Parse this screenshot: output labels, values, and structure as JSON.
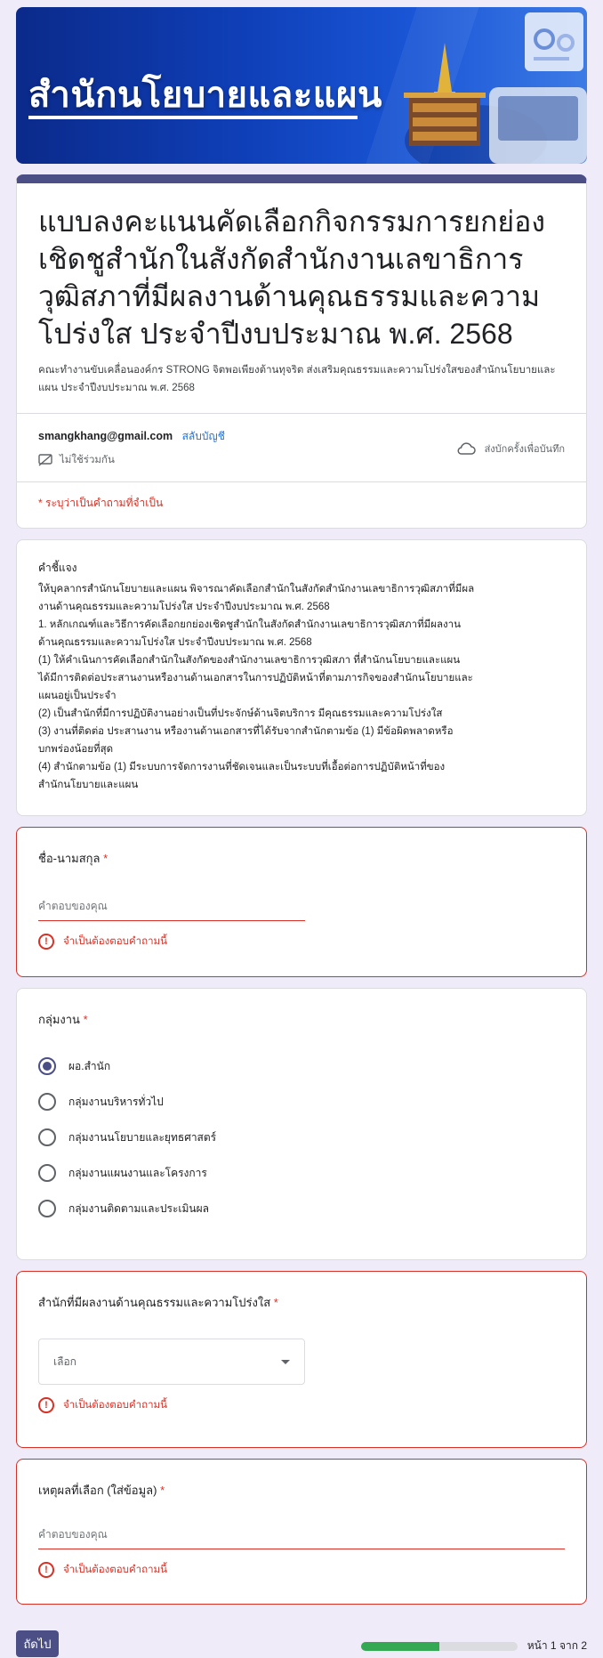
{
  "banner": {
    "title": "สำนักนโยบายและแผน"
  },
  "form": {
    "title": "แบบลงคะแนนคัดเลือกกิจกรรมการยกย่องเชิดชูสำนักในสังกัดสำนักงานเลขาธิการวุฒิสภาที่มีผลงานด้านคุณธรรมและความโปร่งใส ประจำปีงบประมาณ พ.ศ. 2568",
    "description": "คณะทำงานขับเคลื่อนองค์กร STRONG จิตพอเพียงต้านทุจริต ส่งเสริมคุณธรรมและความโปร่งใสของสำนักนโยบายและแผน ประจำปีงบประมาณ พ.ศ. 2568"
  },
  "account": {
    "email": "smangkhang@gmail.com",
    "switch_label": "สลับบัญชี",
    "not_shared": "ไม่ใช้ร่วมกัน",
    "save_draft": "ส่งบักครั้งเพื่อบันทึก",
    "required_note": "* ระบุว่าเป็นคำถามที่จำเป็น"
  },
  "instructions": {
    "heading": "คำชี้แจง",
    "lines": [
      "ให้บุคลากรสำนักนโยบายและแผน พิจารณาคัดเลือกสำนักในสังกัดสำนักงานเลขาธิการวุฒิสภาที่มีผล",
      "งานด้านคุณธรรมและความโปร่งใส ประจำปีงบประมาณ พ.ศ. 2568",
      "1. หลักเกณฑ์และวิธีการคัดเลือกยกย่องเชิดชูสำนักในสังกัดสำนักงานเลขาธิการวุฒิสภาที่มีผลงาน",
      "ด้านคุณธรรมและความโปร่งใส ประจำปีงบประมาณ พ.ศ. 2568",
      "  (1) ให้คำเนินการคัดเลือกสำนักในสังกัดของสำนักงานเลขาธิการวุฒิสภา ที่สำนักนโยบายและแผน",
      "ได้มีการติดต่อประสานงานหรืองานด้านเอกสารในการปฏิบัติหน้าที่ตามภารกิจของสำนักนโยบายและ",
      "แผนอยู่เป็นประจำ",
      "  (2) เป็นสำนักที่มีการปฏิบัติงานอย่างเป็นที่ประจักษ์ด้านจิตบริการ มีคุณธรรมและความโปร่งใส",
      "  (3) งานที่ติดต่อ ประสานงาน หรืองานด้านเอกสารที่ได้รับจากสำนักตามข้อ (1) มีข้อผิดพลาดหรือ",
      "บกพร่องน้อยที่สุด",
      "  (4) สำนักตามข้อ (1) มีระบบการจัดการงานที่ชัดเจนและเป็นระบบที่เอื้อต่อการปฏิบัติหน้าที่ของ",
      "สำนักนโยบายและแผน"
    ]
  },
  "q_name": {
    "title": "ชื่อ-นามสกุล",
    "required": "*",
    "placeholder": "คำตอบของคุณ",
    "error": "จำเป็นต้องตอบคำถามนี้"
  },
  "q_group": {
    "title": "กลุ่มงาน",
    "required": "*",
    "options": [
      "ผอ.สำนัก",
      "กลุ่มงานบริหารทั่วไป",
      "กลุ่มงานนโยบายและยุทธศาสตร์",
      "กลุ่มงานแผนงานและโครงการ",
      "กลุ่มงานติดตามและประเมินผล"
    ],
    "selected_index": 0
  },
  "q_office": {
    "title": "สำนักที่มีผลงานด้านคุณธรรมและความโปร่งใส",
    "required": "*",
    "select_value": "เลือก",
    "error": "จำเป็นต้องตอบคำถามนี้"
  },
  "q_reason": {
    "title": "เหตุผลที่เลือก (ใส่ข้อมูล)",
    "required": "*",
    "placeholder": "คำตอบของคุณ",
    "error": "จำเป็นต้องตอบคำถามนี้"
  },
  "footer": {
    "next_label": "ถัดไป",
    "progress": 0.5,
    "page_count": "หน้า 1 จาก 2"
  },
  "colors": {
    "theme": "#4b4f86",
    "error": "#d93025",
    "background": "#f0ebf8",
    "progress": "#34a853"
  }
}
